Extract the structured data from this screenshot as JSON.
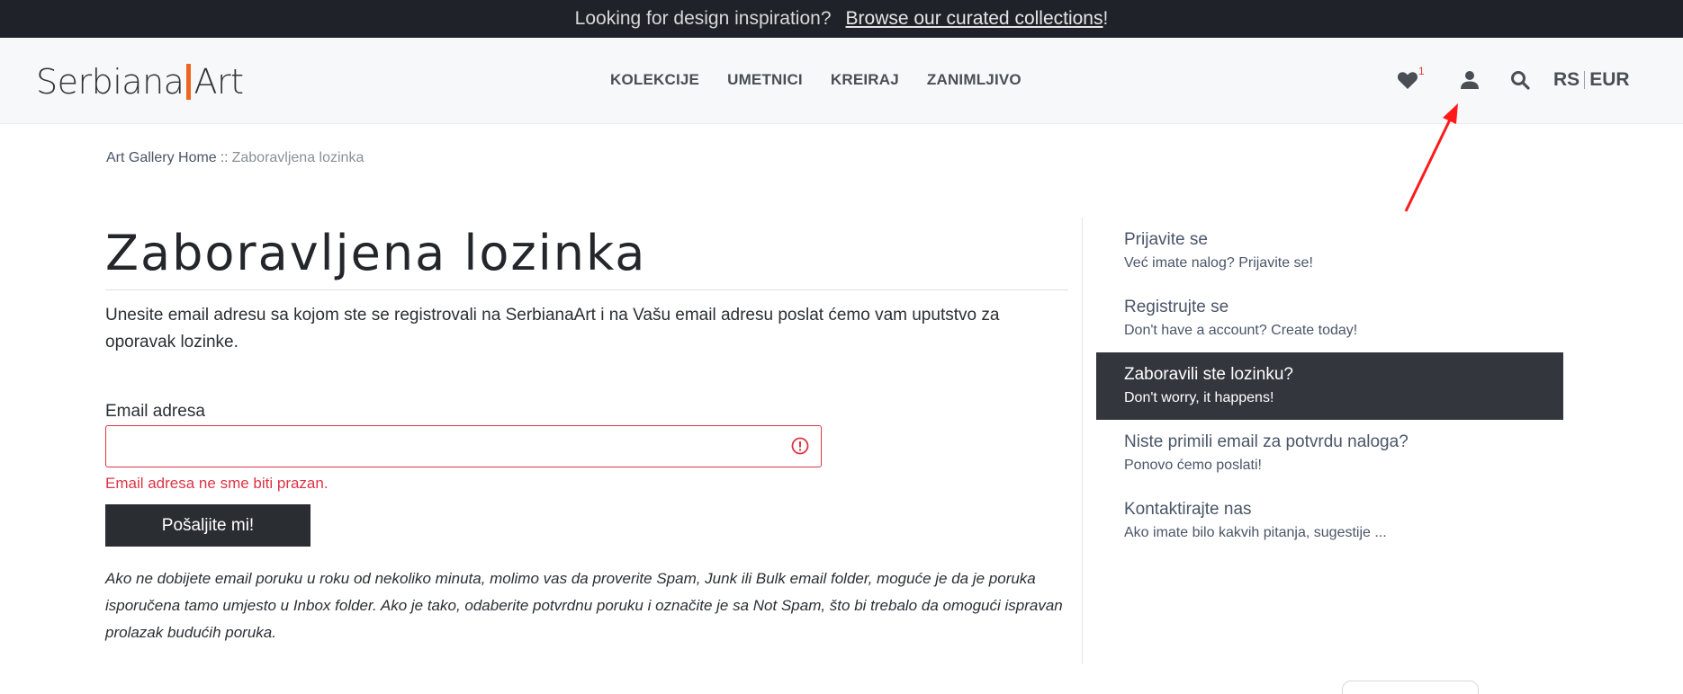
{
  "promo": {
    "text": "Looking for design inspiration?",
    "link": "Browse our curated collections",
    "suffix": "!"
  },
  "header": {
    "logo_left": "Serbiana",
    "logo_right": "Art",
    "nav": [
      "KOLEKCIJE",
      "UMETNICI",
      "KREIRAJ",
      "ZANIMLJIVO"
    ],
    "wishlist_count": "1",
    "lang": "RS",
    "currency": "EUR",
    "icons": [
      "heart-icon",
      "user-icon",
      "search-icon"
    ]
  },
  "breadcrumb": {
    "home": "Art Gallery Home",
    "separator": "::",
    "current": "Zaboravljena lozinka"
  },
  "main": {
    "title": "Zaboravljena lozinka",
    "intro": "Unesite email adresu sa kojom ste se registrovali na SerbianaArt i na Vašu email adresu poslat ćemo vam uputstvo za oporavak lozinke.",
    "email_label": "Email adresa",
    "email_value": "",
    "email_error": "Email adresa ne sme biti prazan.",
    "submit_label": "Pošaljite mi!",
    "note": "Ako ne dobijete email poruku u roku od nekoliko minuta, molimo vas da proverite Spam, Junk ili Bulk email folder, moguće je da je poruka isporučena tamo umjesto u Inbox folder. Ako je tako, odaberite potvrdnu poruku i označite je sa Not Spam, što bi trebalo da omogući ispravan prolazak budućih poruka."
  },
  "sidebar": {
    "items": [
      {
        "title": "Prijavite se",
        "subtitle": "Već imate nalog? Prijavite se!",
        "active": false
      },
      {
        "title": "Registrujte se",
        "subtitle": "Don't have a account? Create today!",
        "active": false
      },
      {
        "title": "Zaboravili ste lozinku?",
        "subtitle": "Don't worry, it happens!",
        "active": true
      },
      {
        "title": "Niste primili email za potvrdu naloga?",
        "subtitle": "Ponovo ćemo poslati!",
        "active": false
      },
      {
        "title": "Kontaktirajte nas",
        "subtitle": "Ako imate bilo kakvih pitanja, sugestije ...",
        "active": false
      }
    ]
  },
  "colors": {
    "topbar_bg": "#1f2329",
    "logo_accent": "#f0641e",
    "error": "#dc3545",
    "active_menu_bg": "#33363d",
    "annotation_arrow": "#ff1a1a"
  }
}
